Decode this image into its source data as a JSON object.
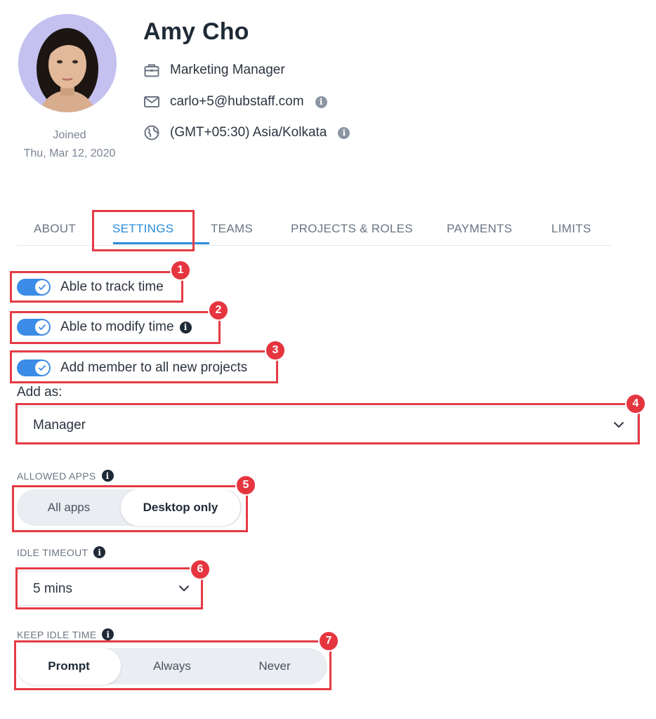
{
  "profile": {
    "name": "Amy Cho",
    "job_title": "Marketing Manager",
    "email": "carlo+5@hubstaff.com",
    "timezone": "(GMT+05:30) Asia/Kolkata",
    "joined_label": "Joined",
    "joined_date": "Thu, Mar 12, 2020",
    "info_glyph": "i"
  },
  "tabs": [
    {
      "label": "ABOUT",
      "active": false
    },
    {
      "label": "SETTINGS",
      "active": true
    },
    {
      "label": "TEAMS",
      "active": false
    },
    {
      "label": "PROJECTS & ROLES",
      "active": false
    },
    {
      "label": "PAYMENTS",
      "active": false
    },
    {
      "label": "LIMITS",
      "active": false
    }
  ],
  "settings": {
    "track_time_label": "Able to track time",
    "modify_time_label": "Able to modify time",
    "add_to_projects_label": "Add member to all new projects",
    "add_as_label": "Add as:",
    "add_as_value": "Manager",
    "allowed_apps": {
      "label": "ALLOWED APPS",
      "options": [
        "All apps",
        "Desktop only"
      ],
      "selected": "Desktop only"
    },
    "idle_timeout": {
      "label": "IDLE TIMEOUT",
      "value": "5 mins"
    },
    "keep_idle_time": {
      "label": "KEEP IDLE TIME",
      "options": [
        "Prompt",
        "Always",
        "Never"
      ],
      "selected": "Prompt"
    }
  },
  "badges": [
    "1",
    "2",
    "3",
    "4",
    "5",
    "6",
    "7"
  ],
  "colors": {
    "accent": "#2a8bd8",
    "toggle_on": "#3b8ce6",
    "annotation": "#e43b45",
    "avatar_bg": "#c4c0ef"
  },
  "icons": [
    "briefcase-icon",
    "envelope-icon",
    "globe-icon",
    "info-icon",
    "check-icon",
    "chevron-down-icon"
  ]
}
